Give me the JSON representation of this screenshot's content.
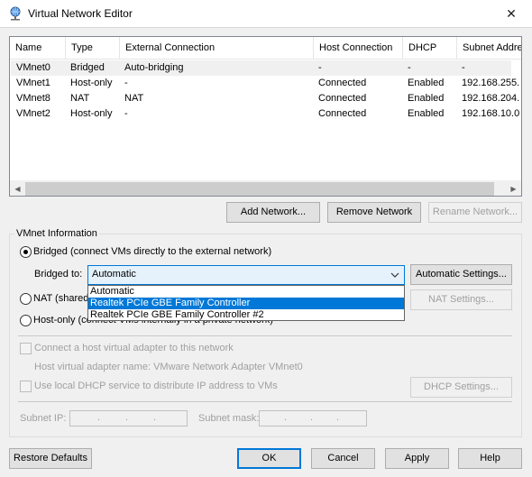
{
  "window": {
    "title": "Virtual Network Editor",
    "close_glyph": "✕"
  },
  "table": {
    "headers": [
      "Name",
      "Type",
      "External Connection",
      "Host Connection",
      "DHCP",
      "Subnet Addre"
    ],
    "rows": [
      [
        "VMnet0",
        "Bridged",
        "Auto-bridging",
        "-",
        "-",
        "-"
      ],
      [
        "VMnet1",
        "Host-only",
        "-",
        "Connected",
        "Enabled",
        "192.168.255."
      ],
      [
        "VMnet8",
        "NAT",
        "NAT",
        "Connected",
        "Enabled",
        "192.168.204."
      ],
      [
        "VMnet2",
        "Host-only",
        "-",
        "Connected",
        "Enabled",
        "192.168.10.0"
      ]
    ],
    "selected_row": 0
  },
  "list_buttons": {
    "add": "Add Network...",
    "remove": "Remove Network",
    "rename": "Rename Network..."
  },
  "vmnet_info": {
    "group_title": "VMnet Information",
    "bridged_label": "Bridged (connect VMs directly to the external network)",
    "bridged_to_label": "Bridged to:",
    "bridged_to_value": "Automatic",
    "auto_settings_button": "Automatic Settings...",
    "dropdown_options": [
      "Automatic",
      "Realtek PCIe GBE Family Controller",
      "Realtek PCIe GBE Family Controller #2"
    ],
    "dropdown_highlighted": 1,
    "nat_label": "NAT (shared",
    "nat_settings_button": "NAT Settings...",
    "hostonly_label": "Host-only (connect VMs internally in a private network)",
    "connect_adapter_label": "Connect a host virtual adapter to this network",
    "adapter_name_label": "Host virtual adapter name: VMware Network Adapter VMnet0",
    "dhcp_label": "Use local DHCP service to distribute IP address to VMs",
    "dhcp_settings_button": "DHCP Settings...",
    "subnet_ip_label": "Subnet IP:",
    "subnet_mask_label": "Subnet mask:",
    "ip_dots": "."
  },
  "footer": {
    "restore": "Restore Defaults",
    "ok": "OK",
    "cancel": "Cancel",
    "apply": "Apply",
    "help": "Help"
  },
  "colors": {
    "accent": "#0078d7",
    "highlight": "#0078d7"
  }
}
